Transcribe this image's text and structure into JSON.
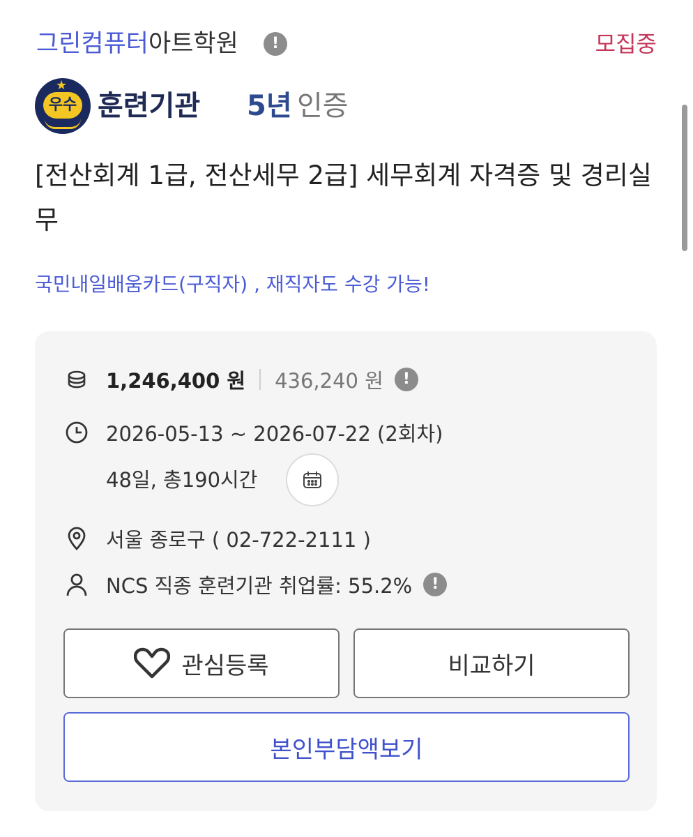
{
  "header": {
    "academy_highlight": "그린컴퓨터",
    "academy_rest": "아트학원",
    "info_glyph": "!",
    "status": "모집중"
  },
  "badge": {
    "emblem_text": "우수",
    "org": "훈련기관",
    "years": "5년",
    "cert": "인증"
  },
  "course": {
    "title": "[전산회계 1급, 전산세무 2급] 세무회계 자격증 및 경리실무",
    "promo": "국민내일배움카드(구직자) , 재직자도 수강 가능!"
  },
  "details": {
    "price_total": "1,246,400 원",
    "price_self": "436,240 원",
    "period": "2026-05-13 ~ 2026-07-22 (2회차)",
    "duration": "48일, 총190시간",
    "location": "서울 종로구 ( 02-722-2111 )",
    "employment": "NCS 직종 훈련기관 취업률: 55.2%"
  },
  "actions": {
    "favorite": "관심등록",
    "compare": "비교하기",
    "self_cost": "본인부담액보기"
  },
  "icons": {
    "price": "coins-icon",
    "period": "clock-icon",
    "calendar": "calendar-icon",
    "location": "location-pin-icon",
    "employment": "person-icon",
    "info": "info-icon",
    "favorite": "heart-icon"
  },
  "colors": {
    "brand_blue": "#4a5bd4",
    "status_red": "#c5365a",
    "card_bg": "#f5f5f5",
    "emblem_navy": "#1a2a5e",
    "emblem_gold": "#f3c623"
  }
}
